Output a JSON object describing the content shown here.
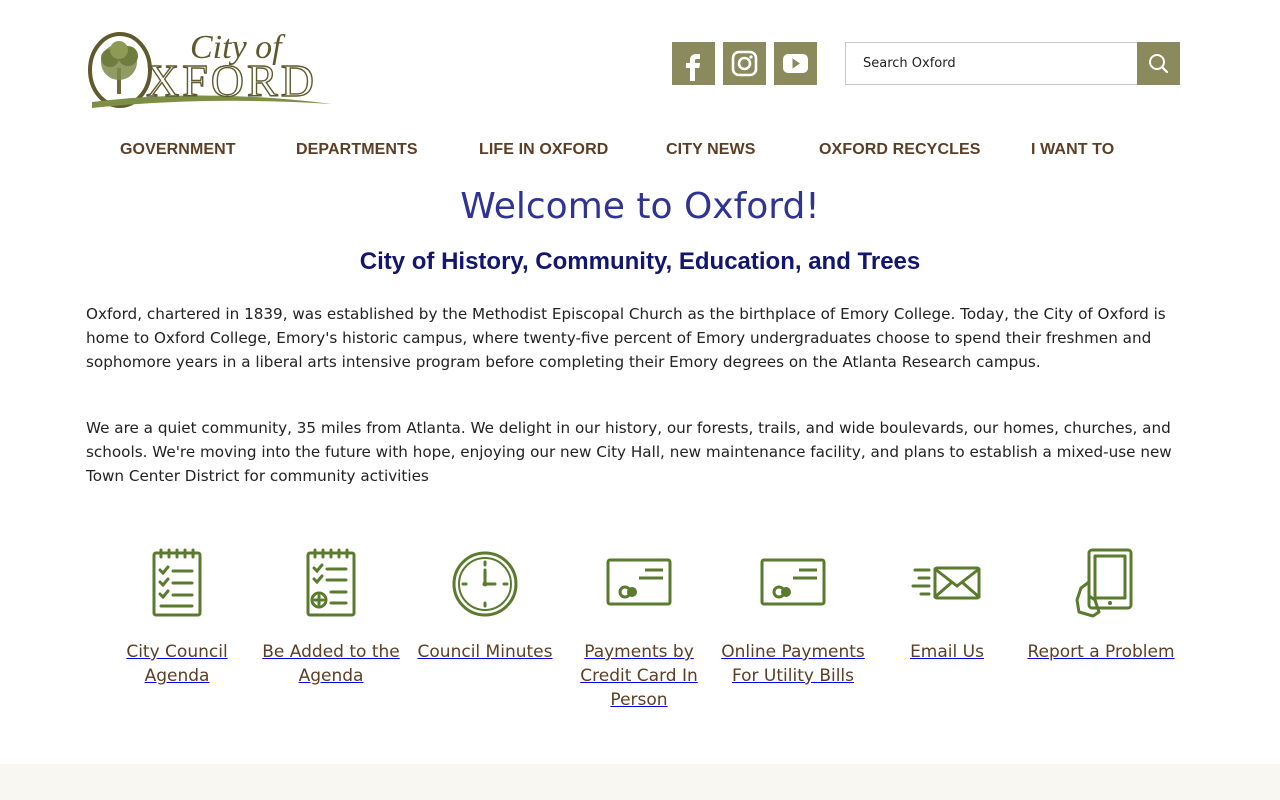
{
  "logo": {
    "line1": "City of",
    "line2": "XFORD",
    "initial": "O"
  },
  "social": [
    {
      "name": "facebook",
      "icon": "facebook-icon"
    },
    {
      "name": "instagram",
      "icon": "instagram-icon"
    },
    {
      "name": "youtube",
      "icon": "youtube-icon"
    }
  ],
  "search": {
    "placeholder": "Search Oxford",
    "button_icon": "search-icon"
  },
  "nav": [
    {
      "label": "GOVERNMENT"
    },
    {
      "label": "DEPARTMENTS"
    },
    {
      "label": "LIFE IN OXFORD"
    },
    {
      "label": "CITY NEWS"
    },
    {
      "label": "OXFORD RECYCLES"
    },
    {
      "label": "I WANT TO"
    }
  ],
  "main": {
    "title": "Welcome to Oxford!",
    "subtitle": "City of History, Community, Education, and Trees",
    "paragraphs": [
      "Oxford, chartered in 1839, was established by the Methodist Episcopal Church as the birthplace of Emory College. Today, the City of Oxford is home to Oxford College, Emory's historic campus, where twenty-five percent of Emory undergraduates choose to spend their freshmen and sophomore years in a liberal arts intensive program before completing their Emory degrees on the Atlanta Research campus.",
      "We are a quiet community, 35 miles from Atlanta. We delight in our history, our forests, trails, and wide boulevards, our homes, churches, and schools. We're moving into the future with hope, enjoying our new City Hall, new maintenance facility, and plans to establish a mixed-use new Town Center District for community activities"
    ]
  },
  "quick_links": [
    {
      "label": "City Council Agenda",
      "icon": "notepad-checklist-icon"
    },
    {
      "label": "Be Added to the Agenda",
      "icon": "notepad-add-icon"
    },
    {
      "label": "Council Minutes",
      "icon": "clock-icon"
    },
    {
      "label": "Payments by Credit Card In Person",
      "icon": "credit-card-icon"
    },
    {
      "label": "Online Payments For Utility Bills",
      "icon": "credit-card-icon"
    },
    {
      "label": "Email Us",
      "icon": "email-envelope-icon"
    },
    {
      "label": "Report a Problem",
      "icon": "tablet-hand-icon"
    }
  ],
  "colors": {
    "brand_olive": "#8a8a5c",
    "icon_green": "#5a7a2e",
    "nav_brown": "#5b3e25",
    "title_blue": "#2f3494",
    "subtitle_navy": "#12166e"
  }
}
